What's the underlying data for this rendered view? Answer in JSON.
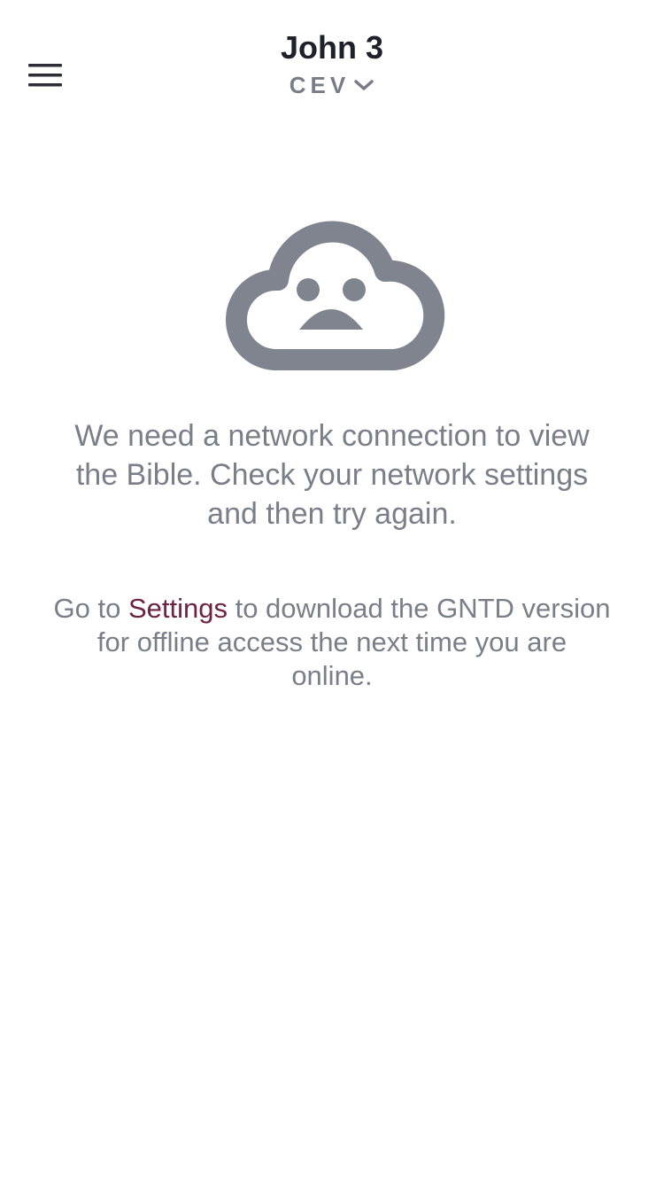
{
  "header": {
    "chapter_title": "John 3",
    "version": "CEV",
    "menu_icon": "hamburger-menu-icon",
    "version_dropdown_icon": "chevron-down-icon"
  },
  "offline": {
    "icon": "sad-cloud-icon",
    "message": "We need a network connection to view the Bible. Check your network settings and then try again.",
    "hint_prefix": "Go to ",
    "hint_link": "Settings",
    "hint_suffix": " to download the GNTD version for offline access the next time you are online."
  },
  "colors": {
    "title": "#1e2129",
    "muted_text": "#7a7e89",
    "icon": "#80848f",
    "link": "#6e2344",
    "background": "#ffffff"
  }
}
